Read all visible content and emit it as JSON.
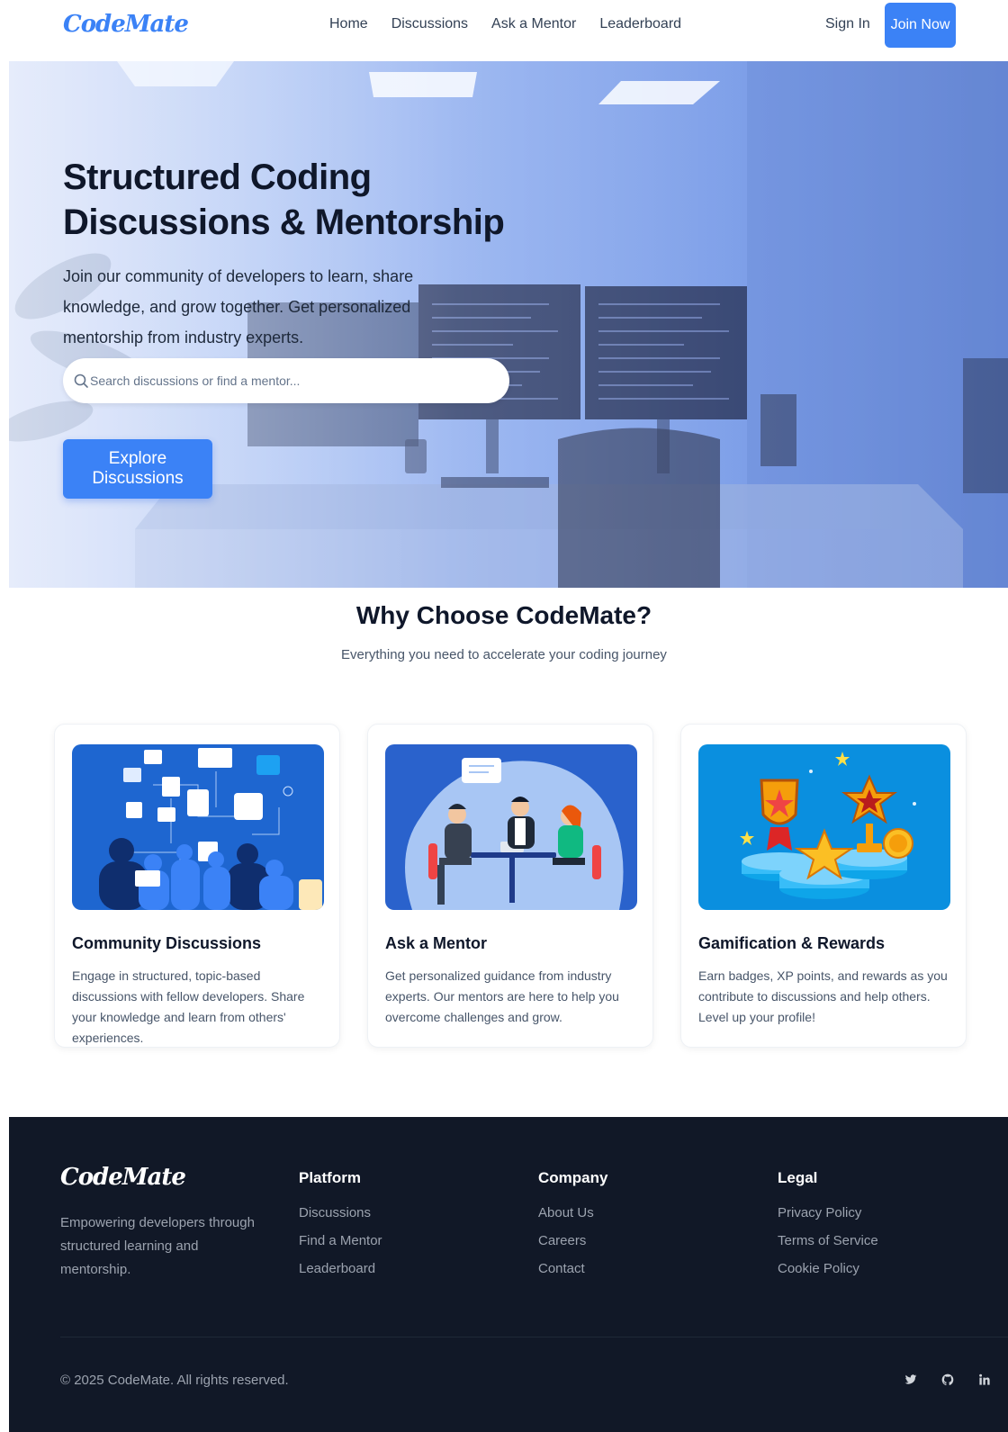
{
  "nav": {
    "logo": "CodeMate",
    "links": [
      "Home",
      "Discussions",
      "Ask a Mentor",
      "Leaderboard"
    ],
    "sign_in": "Sign In",
    "join": "Join Now"
  },
  "hero": {
    "title": "Structured Coding Discussions & Mentorship",
    "subtitle": "Join our community of developers to learn, share knowledge, and grow together. Get personalized mentorship from industry experts.",
    "search_placeholder": "Search discussions or find a mentor...",
    "cta": "Explore Discussions"
  },
  "features": {
    "title": "Why Choose CodeMate?",
    "subtitle": "Everything you need to accelerate your coding journey",
    "cards": [
      {
        "title": "Community Discussions",
        "desc": "Engage in structured, topic-based discussions with fellow developers. Share your knowledge and learn from others' experiences."
      },
      {
        "title": "Ask a Mentor",
        "desc": "Get personalized guidance from industry experts. Our mentors are here to help you overcome challenges and grow."
      },
      {
        "title": "Gamification & Rewards",
        "desc": "Earn badges, XP points, and rewards as you contribute to discussions and help others. Level up your profile!"
      }
    ]
  },
  "footer": {
    "logo": "CodeMate",
    "tagline": "Empowering developers through structured learning and mentorship.",
    "columns": [
      {
        "heading": "Platform",
        "links": [
          "Discussions",
          "Find a Mentor",
          "Leaderboard"
        ]
      },
      {
        "heading": "Company",
        "links": [
          "About Us",
          "Careers",
          "Contact"
        ]
      },
      {
        "heading": "Legal",
        "links": [
          "Privacy Policy",
          "Terms of Service",
          "Cookie Policy"
        ]
      }
    ],
    "copyright": "© 2025 CodeMate. All rights reserved.",
    "social": [
      "twitter-icon",
      "github-icon",
      "linkedin-icon"
    ]
  },
  "colors": {
    "accent": "#3b82f6",
    "footer_bg": "#111827",
    "heading": "#0f172a"
  }
}
